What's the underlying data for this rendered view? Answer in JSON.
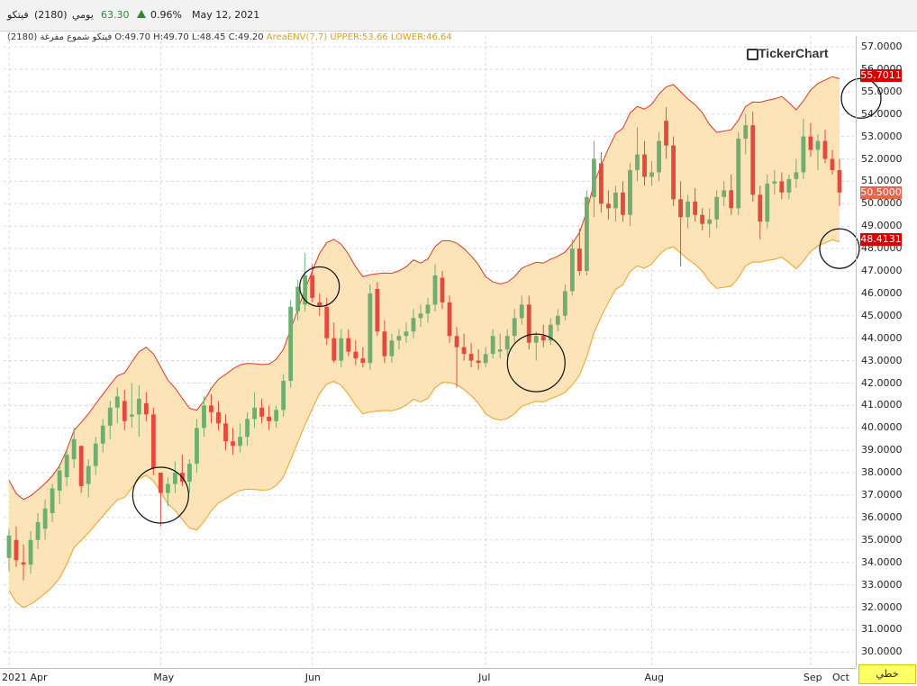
{
  "header": {
    "symbol_name": "فيتكو",
    "symbol_code": "(2180)",
    "period": "يومي",
    "last_price": "63.30",
    "change_pct": "0.96%",
    "date": "May 12, 2021"
  },
  "legend": {
    "ohlc_text": "فيتكو شموع مفرغة (2180) O:49.70 H:49.70 L:48.45 C:49.20",
    "envelope_text": "AreaENV(7,7)  UPPER:53.66  LOWER:46.64"
  },
  "brand": "TickerChart",
  "footer_button": "خطي",
  "colors": {
    "up": "#6fae6f",
    "down": "#e24b3b",
    "band_fill": "#fde2b4",
    "upper_line": "#d9372a",
    "lower_line": "#d9372a",
    "tag_red": "#d60000",
    "tag_last": "#e8644f"
  },
  "chart_data": {
    "type": "candlestick",
    "y_axis_labels": [
      "57.0000",
      "56.0000",
      "55.0000",
      "54.0000",
      "53.0000",
      "52.0000",
      "51.0000",
      "50.0000",
      "49.0000",
      "48.0000",
      "47.0000",
      "46.0000",
      "45.0000",
      "44.0000",
      "43.0000",
      "42.0000",
      "41.0000",
      "40.0000",
      "39.0000",
      "38.0000",
      "37.0000",
      "36.0000",
      "35.0000",
      "34.0000",
      "33.0000",
      "32.0000",
      "31.0000",
      "30.0000"
    ],
    "ylim": [
      29.4,
      57.6
    ],
    "x_labels": [
      "2021 Apr",
      "May",
      "Jun",
      "Jul",
      "Aug",
      "Sep",
      "Oct"
    ],
    "price_tags": [
      {
        "label": "55.7011",
        "value": 55.7011,
        "kind": "upper"
      },
      {
        "label": "50.5000",
        "value": 50.5,
        "kind": "last"
      },
      {
        "label": "48.4131",
        "value": 48.4131,
        "kind": "lower"
      }
    ],
    "annotated_circles_on_values": [
      37.0,
      46.3,
      42.9,
      48.0,
      54.7
    ],
    "candles": [
      {
        "o": 34.2,
        "h": 35.5,
        "l": 33.6,
        "c": 35.2
      },
      {
        "o": 35.0,
        "h": 35.6,
        "l": 33.8,
        "c": 34.1
      },
      {
        "o": 34.0,
        "h": 34.8,
        "l": 33.2,
        "c": 33.9
      },
      {
        "o": 33.9,
        "h": 35.4,
        "l": 33.5,
        "c": 35.0
      },
      {
        "o": 35.0,
        "h": 36.2,
        "l": 34.6,
        "c": 35.8
      },
      {
        "o": 35.5,
        "h": 36.8,
        "l": 35.0,
        "c": 36.4
      },
      {
        "o": 36.2,
        "h": 37.5,
        "l": 35.8,
        "c": 37.3
      },
      {
        "o": 37.2,
        "h": 38.4,
        "l": 36.6,
        "c": 38.1
      },
      {
        "o": 37.8,
        "h": 39.0,
        "l": 37.4,
        "c": 38.8
      },
      {
        "o": 38.6,
        "h": 40.0,
        "l": 38.2,
        "c": 39.5
      },
      {
        "o": 39.2,
        "h": 38.7,
        "l": 37.1,
        "c": 37.4
      },
      {
        "o": 37.5,
        "h": 38.6,
        "l": 36.9,
        "c": 38.3
      },
      {
        "o": 38.3,
        "h": 39.6,
        "l": 37.9,
        "c": 39.3
      },
      {
        "o": 39.3,
        "h": 40.4,
        "l": 38.9,
        "c": 40.1
      },
      {
        "o": 40.1,
        "h": 41.2,
        "l": 39.5,
        "c": 40.9
      },
      {
        "o": 40.9,
        "h": 41.8,
        "l": 40.2,
        "c": 41.4
      },
      {
        "o": 41.2,
        "h": 41.7,
        "l": 39.9,
        "c": 40.3
      },
      {
        "o": 40.5,
        "h": 42.0,
        "l": 40.0,
        "c": 40.6
      },
      {
        "o": 40.6,
        "h": 41.9,
        "l": 39.6,
        "c": 41.3
      },
      {
        "o": 41.1,
        "h": 41.6,
        "l": 40.3,
        "c": 40.6
      },
      {
        "o": 40.6,
        "h": 40.9,
        "l": 37.9,
        "c": 38.2
      },
      {
        "o": 38.0,
        "h": 37.6,
        "l": 35.6,
        "c": 37.1
      },
      {
        "o": 37.1,
        "h": 37.8,
        "l": 36.5,
        "c": 37.5
      },
      {
        "o": 37.5,
        "h": 38.5,
        "l": 37.1,
        "c": 38.0
      },
      {
        "o": 38.0,
        "h": 38.8,
        "l": 37.4,
        "c": 37.6
      },
      {
        "o": 37.6,
        "h": 38.6,
        "l": 37.1,
        "c": 38.4
      },
      {
        "o": 38.4,
        "h": 40.4,
        "l": 38.0,
        "c": 40.0
      },
      {
        "o": 40.0,
        "h": 41.4,
        "l": 39.6,
        "c": 41.0
      },
      {
        "o": 41.0,
        "h": 41.5,
        "l": 40.2,
        "c": 40.7
      },
      {
        "o": 40.7,
        "h": 41.2,
        "l": 39.9,
        "c": 40.2
      },
      {
        "o": 40.2,
        "h": 40.6,
        "l": 39.0,
        "c": 39.4
      },
      {
        "o": 39.4,
        "h": 40.0,
        "l": 38.8,
        "c": 39.2
      },
      {
        "o": 39.2,
        "h": 40.2,
        "l": 38.9,
        "c": 39.6
      },
      {
        "o": 39.6,
        "h": 40.7,
        "l": 39.2,
        "c": 40.4
      },
      {
        "o": 40.4,
        "h": 41.6,
        "l": 40.0,
        "c": 40.9
      },
      {
        "o": 40.9,
        "h": 41.3,
        "l": 40.2,
        "c": 40.5
      },
      {
        "o": 40.5,
        "h": 41.0,
        "l": 39.9,
        "c": 40.3
      },
      {
        "o": 40.3,
        "h": 41.0,
        "l": 40.0,
        "c": 40.8
      },
      {
        "o": 40.8,
        "h": 42.4,
        "l": 40.5,
        "c": 42.1
      },
      {
        "o": 42.1,
        "h": 45.7,
        "l": 41.8,
        "c": 45.4
      },
      {
        "o": 45.2,
        "h": 46.6,
        "l": 44.8,
        "c": 46.3
      },
      {
        "o": 45.5,
        "h": 47.8,
        "l": 45.2,
        "c": 46.8
      },
      {
        "o": 46.8,
        "h": 47.3,
        "l": 45.6,
        "c": 45.8
      },
      {
        "o": 45.6,
        "h": 46.0,
        "l": 45.0,
        "c": 45.4
      },
      {
        "o": 45.4,
        "h": 45.8,
        "l": 43.7,
        "c": 44.0
      },
      {
        "o": 44.0,
        "h": 44.7,
        "l": 42.9,
        "c": 43.0
      },
      {
        "o": 43.0,
        "h": 44.4,
        "l": 42.7,
        "c": 44.0
      },
      {
        "o": 44.0,
        "h": 44.4,
        "l": 43.2,
        "c": 43.4
      },
      {
        "o": 43.4,
        "h": 43.9,
        "l": 42.8,
        "c": 43.1
      },
      {
        "o": 43.1,
        "h": 43.6,
        "l": 42.7,
        "c": 42.9
      },
      {
        "o": 42.9,
        "h": 46.4,
        "l": 42.6,
        "c": 46.0
      },
      {
        "o": 46.2,
        "h": 46.5,
        "l": 44.1,
        "c": 44.3
      },
      {
        "o": 44.3,
        "h": 44.8,
        "l": 42.9,
        "c": 43.2
      },
      {
        "o": 43.2,
        "h": 44.2,
        "l": 42.9,
        "c": 43.9
      },
      {
        "o": 43.9,
        "h": 44.4,
        "l": 43.5,
        "c": 44.1
      },
      {
        "o": 44.1,
        "h": 44.7,
        "l": 43.8,
        "c": 44.3
      },
      {
        "o": 44.3,
        "h": 45.3,
        "l": 44.0,
        "c": 44.9
      },
      {
        "o": 44.9,
        "h": 45.5,
        "l": 44.5,
        "c": 45.1
      },
      {
        "o": 45.1,
        "h": 45.8,
        "l": 44.7,
        "c": 45.5
      },
      {
        "o": 45.5,
        "h": 47.3,
        "l": 45.2,
        "c": 46.8
      },
      {
        "o": 46.7,
        "h": 47.0,
        "l": 45.3,
        "c": 45.6
      },
      {
        "o": 45.6,
        "h": 45.9,
        "l": 43.8,
        "c": 44.1
      },
      {
        "o": 44.1,
        "h": 44.5,
        "l": 41.8,
        "c": 43.6
      },
      {
        "o": 43.6,
        "h": 44.2,
        "l": 43.0,
        "c": 43.3
      },
      {
        "o": 43.3,
        "h": 43.8,
        "l": 42.7,
        "c": 43.0
      },
      {
        "o": 43.0,
        "h": 43.5,
        "l": 42.6,
        "c": 42.9
      },
      {
        "o": 42.9,
        "h": 43.6,
        "l": 42.7,
        "c": 43.3
      },
      {
        "o": 43.3,
        "h": 44.4,
        "l": 43.1,
        "c": 44.1
      },
      {
        "o": 43.4,
        "h": 44.2,
        "l": 43.1,
        "c": 43.5
      },
      {
        "o": 43.5,
        "h": 44.4,
        "l": 43.2,
        "c": 44.1
      },
      {
        "o": 44.1,
        "h": 45.3,
        "l": 43.8,
        "c": 44.9
      },
      {
        "o": 44.9,
        "h": 45.9,
        "l": 44.6,
        "c": 45.5
      },
      {
        "o": 45.5,
        "h": 45.9,
        "l": 43.5,
        "c": 43.8
      },
      {
        "o": 43.8,
        "h": 44.3,
        "l": 43.0,
        "c": 44.1
      },
      {
        "o": 44.1,
        "h": 44.6,
        "l": 43.6,
        "c": 43.9
      },
      {
        "o": 43.9,
        "h": 44.9,
        "l": 43.7,
        "c": 44.6
      },
      {
        "o": 44.6,
        "h": 45.3,
        "l": 44.3,
        "c": 45.0
      },
      {
        "o": 45.0,
        "h": 46.4,
        "l": 44.8,
        "c": 46.1
      },
      {
        "o": 46.1,
        "h": 48.4,
        "l": 45.9,
        "c": 48.0
      },
      {
        "o": 48.0,
        "h": 48.9,
        "l": 46.8,
        "c": 47.0
      },
      {
        "o": 47.0,
        "h": 50.6,
        "l": 46.8,
        "c": 50.3
      },
      {
        "o": 50.3,
        "h": 52.8,
        "l": 49.4,
        "c": 52.0
      },
      {
        "o": 51.8,
        "h": 52.3,
        "l": 49.6,
        "c": 50.0
      },
      {
        "o": 50.0,
        "h": 50.6,
        "l": 49.3,
        "c": 49.8
      },
      {
        "o": 49.8,
        "h": 50.8,
        "l": 49.2,
        "c": 50.5
      },
      {
        "o": 50.5,
        "h": 51.0,
        "l": 49.2,
        "c": 49.5
      },
      {
        "o": 49.5,
        "h": 51.8,
        "l": 49.0,
        "c": 51.5
      },
      {
        "o": 51.5,
        "h": 53.4,
        "l": 51.0,
        "c": 52.2
      },
      {
        "o": 52.2,
        "h": 52.8,
        "l": 50.8,
        "c": 51.2
      },
      {
        "o": 51.2,
        "h": 51.9,
        "l": 50.8,
        "c": 51.4
      },
      {
        "o": 51.4,
        "h": 53.2,
        "l": 51.0,
        "c": 52.8
      },
      {
        "o": 53.7,
        "h": 54.3,
        "l": 52.0,
        "c": 52.6
      },
      {
        "o": 52.6,
        "h": 53.0,
        "l": 49.9,
        "c": 50.2
      },
      {
        "o": 50.2,
        "h": 51.0,
        "l": 47.2,
        "c": 49.4
      },
      {
        "o": 49.4,
        "h": 50.4,
        "l": 48.9,
        "c": 50.1
      },
      {
        "o": 50.1,
        "h": 50.7,
        "l": 49.2,
        "c": 49.5
      },
      {
        "o": 49.5,
        "h": 49.8,
        "l": 48.8,
        "c": 49.1
      },
      {
        "o": 49.1,
        "h": 49.8,
        "l": 48.5,
        "c": 49.3
      },
      {
        "o": 49.3,
        "h": 50.6,
        "l": 48.9,
        "c": 50.3
      },
      {
        "o": 50.3,
        "h": 51.0,
        "l": 49.9,
        "c": 50.6
      },
      {
        "o": 50.6,
        "h": 51.3,
        "l": 49.5,
        "c": 49.8
      },
      {
        "o": 49.8,
        "h": 53.2,
        "l": 49.5,
        "c": 52.9
      },
      {
        "o": 52.9,
        "h": 54.0,
        "l": 52.2,
        "c": 53.5
      },
      {
        "o": 53.5,
        "h": 54.1,
        "l": 50.1,
        "c": 50.4
      },
      {
        "o": 50.4,
        "h": 50.8,
        "l": 48.4,
        "c": 49.2
      },
      {
        "o": 49.2,
        "h": 51.3,
        "l": 48.9,
        "c": 50.9
      },
      {
        "o": 50.9,
        "h": 51.5,
        "l": 50.4,
        "c": 51.0
      },
      {
        "o": 51.0,
        "h": 51.4,
        "l": 50.2,
        "c": 50.5
      },
      {
        "o": 50.5,
        "h": 51.3,
        "l": 50.2,
        "c": 51.1
      },
      {
        "o": 51.1,
        "h": 52.0,
        "l": 50.7,
        "c": 51.4
      },
      {
        "o": 51.4,
        "h": 53.8,
        "l": 51.1,
        "c": 53.0
      },
      {
        "o": 53.0,
        "h": 53.6,
        "l": 52.1,
        "c": 52.4
      },
      {
        "o": 52.4,
        "h": 53.1,
        "l": 51.5,
        "c": 52.8
      },
      {
        "o": 52.8,
        "h": 53.3,
        "l": 51.8,
        "c": 52.0
      },
      {
        "o": 52.0,
        "h": 52.4,
        "l": 51.3,
        "c": 51.5
      },
      {
        "o": 51.5,
        "h": 52.0,
        "l": 49.9,
        "c": 50.5
      }
    ]
  }
}
